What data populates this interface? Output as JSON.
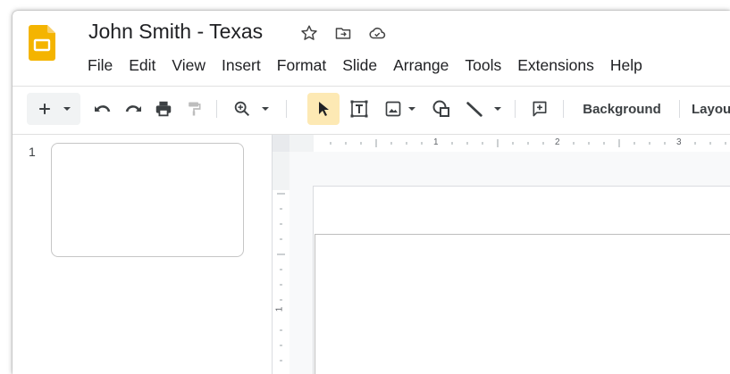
{
  "document": {
    "title": "John Smith - Texas",
    "app_color": "#f4b400"
  },
  "title_icons": [
    "star-icon",
    "move-to-folder-icon",
    "cloud-saved-icon"
  ],
  "menu": [
    {
      "label": "File"
    },
    {
      "label": "Edit"
    },
    {
      "label": "View"
    },
    {
      "label": "Insert"
    },
    {
      "label": "Format"
    },
    {
      "label": "Slide"
    },
    {
      "label": "Arrange"
    },
    {
      "label": "Tools"
    },
    {
      "label": "Extensions"
    },
    {
      "label": "Help"
    }
  ],
  "toolbar": {
    "background_label": "Background",
    "layout_label": "Layou",
    "select_highlight": "#fde9b4"
  },
  "filmstrip": {
    "slide_number": "1"
  },
  "ruler": {
    "h_labels": [
      "1",
      "2",
      "3"
    ],
    "v_labels": [
      "1"
    ]
  }
}
